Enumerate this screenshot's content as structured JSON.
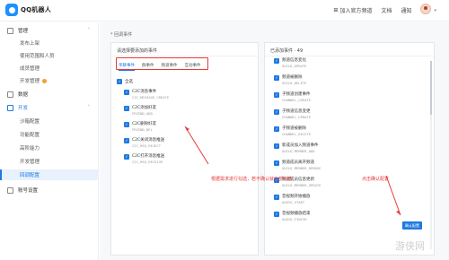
{
  "topbar": {
    "brand": "QQ机器人",
    "join_channel": "加入官方频道",
    "docs": "文档",
    "notify": "通知"
  },
  "sidebar": {
    "manage": "管理",
    "publish": "发布上架",
    "scope": "使用范围和人员",
    "members": "成员管理",
    "dev_manage": "开发管理",
    "data": "数据",
    "develop": "开发",
    "dev_items": [
      "沙箱配置",
      "功能配置",
      "高阶能力",
      "开发管理",
      "回调配置"
    ],
    "account": "账号设置"
  },
  "main": {
    "tip": "* 回调事件",
    "left_title": "请选择要添加的事件",
    "right_title": "已添加事件 · 49",
    "tabs": [
      "单聊事件",
      "群事件",
      "频道事件",
      "互动事件"
    ],
    "select_all": "全选",
    "left_events": [
      {
        "name": "C2C消息事件",
        "code": "C2C_MESSAGE_CREATE"
      },
      {
        "name": "C2C添加好友",
        "code": "FRIEND_ADD"
      },
      {
        "name": "C2C删除好友",
        "code": "FRIEND_DEL"
      },
      {
        "name": "C2C关闭消息推送",
        "code": "C2C_MSG_REJECT"
      },
      {
        "name": "C2C打开消息推送",
        "code": "C2C_MSG_RECEIVE"
      }
    ],
    "right_events": [
      {
        "name": "频道信息变化",
        "code": "GUILD_UPDATE"
      },
      {
        "name": "频道被删除",
        "code": "GUILD_DELETE"
      },
      {
        "name": "子频道创建事件",
        "code": "CHANNEL_CREATE"
      },
      {
        "name": "子频道信息变更",
        "code": "CHANNEL_UPDATE"
      },
      {
        "name": "子频道被删除",
        "code": "CHANNEL_DELETE"
      },
      {
        "name": "新成员加入频道事件",
        "code": "GUILD_MEMBER_ADD"
      },
      {
        "name": "频道成员离开频道",
        "code": "GUILD_MEMBER_REMOVE"
      },
      {
        "name": "频道成员信息更新",
        "code": "GUILD_MEMBER_UPDATE"
      },
      {
        "name": "音视频开始播放",
        "code": "AUDIO_START"
      },
      {
        "name": "音视频播放结束",
        "code": "AUDIO_FINISH"
      }
    ],
    "annotation_left": "根据需求进行勾选，若不确认就全部勾选",
    "annotation_right": "点击确认配置",
    "confirm_button": "确认配置"
  },
  "watermark": "游侠网",
  "colors": {
    "accent": "#1f7ae0",
    "annotation": "#e53935"
  }
}
